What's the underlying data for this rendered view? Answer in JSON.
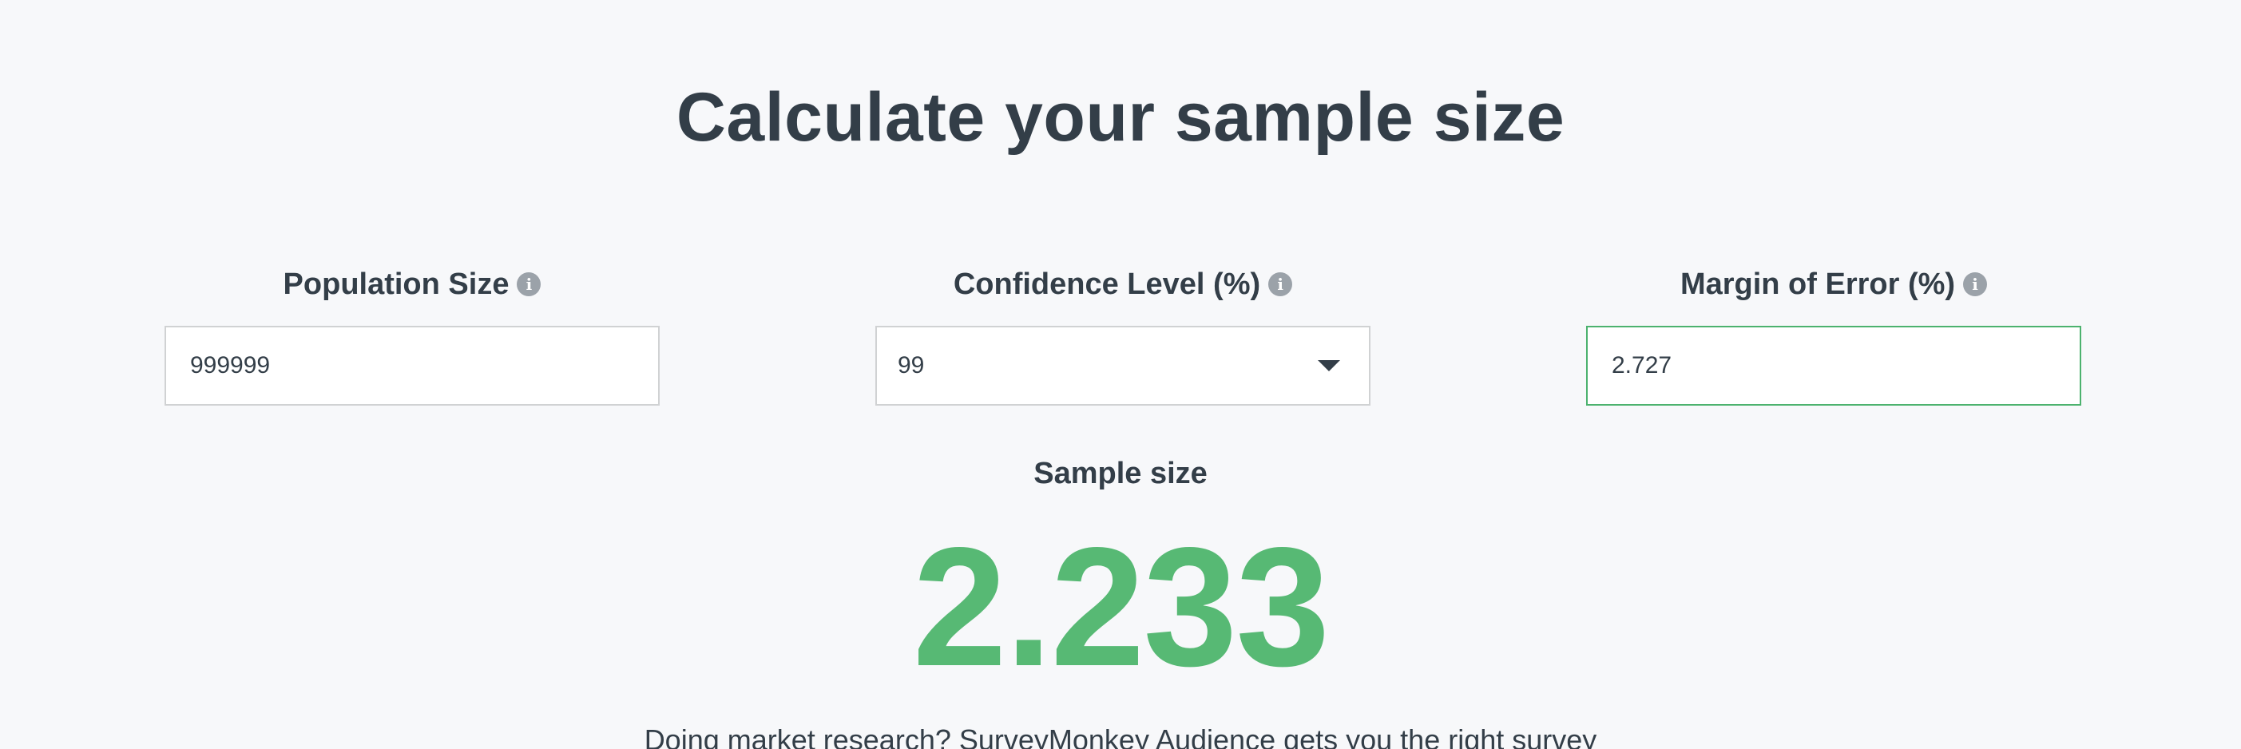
{
  "page": {
    "title": "Calculate your sample size"
  },
  "fields": {
    "population": {
      "label": "Population Size",
      "info_icon": "info-icon",
      "value": "999999"
    },
    "confidence": {
      "label": "Confidence Level (%)",
      "info_icon": "info-icon",
      "value": "99",
      "caret_icon": "chevron-down-icon"
    },
    "margin": {
      "label": "Margin of Error (%)",
      "info_icon": "info-icon",
      "value": "2.727"
    }
  },
  "result": {
    "label": "Sample size",
    "value": "2.233"
  },
  "promo": {
    "text": "Doing market research? SurveyMonkey Audience gets you the right survey"
  },
  "colors": {
    "background": "#f7f8fa",
    "text": "#333e48",
    "accent_green": "#57b974",
    "active_border": "#4cb26e",
    "field_border": "#d0d2d3",
    "info_icon": "#9ba2a9"
  }
}
